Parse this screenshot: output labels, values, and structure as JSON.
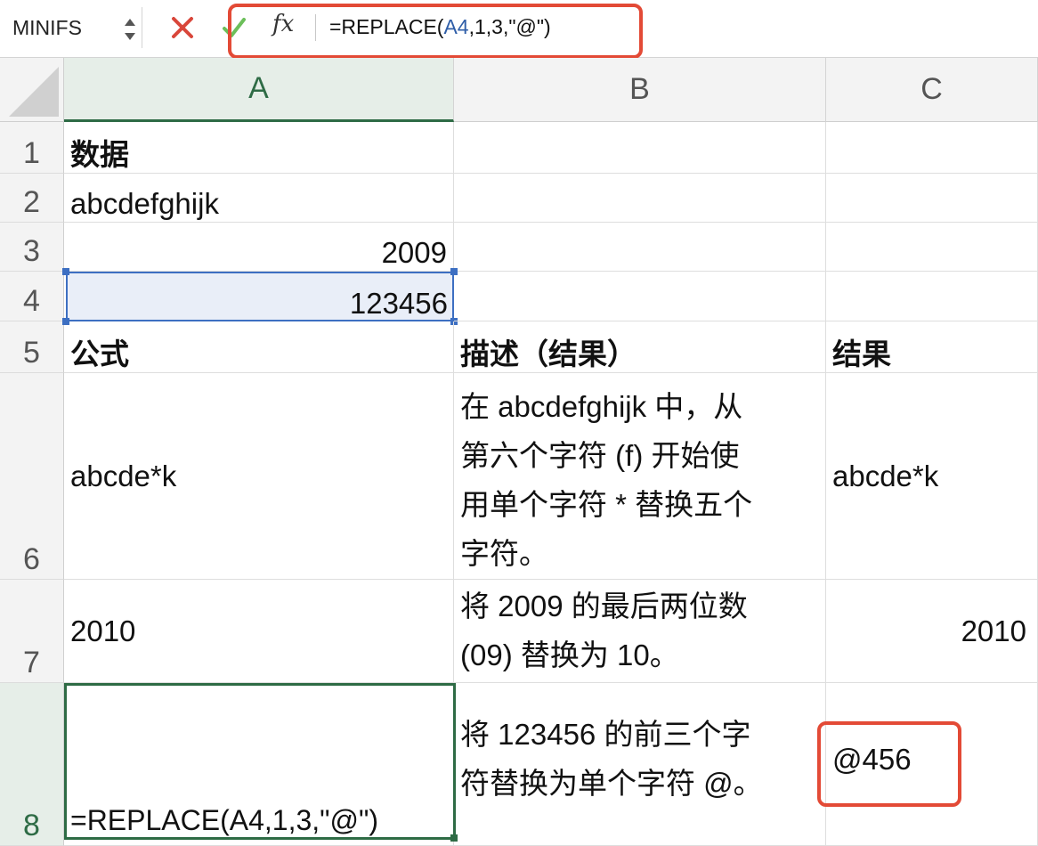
{
  "formula_bar": {
    "name_box": "MINIFS",
    "fx_label": "fx",
    "formula_parts": [
      "=REPLACE(",
      "A4",
      ",1,3,\"@\")"
    ]
  },
  "columns": [
    "A",
    "B",
    "C"
  ],
  "rows": [
    "1",
    "2",
    "3",
    "4",
    "5",
    "6",
    "7",
    "8"
  ],
  "cells": {
    "A1": "数据",
    "A2": "abcdefghijk",
    "A3": "2009",
    "A4": "123456",
    "A5": "公式",
    "B5": "描述（结果）",
    "C5": "结果",
    "A6": "abcde*k",
    "B6_lines": [
      "在 abcdefghijk 中，从",
      "第六个字符 (f) 开始使",
      "用单个字符 * 替换五个",
      "字符。"
    ],
    "C6": "abcde*k",
    "A7": "2010",
    "B7_lines": [
      "将 2009 的最后两位数",
      "(09) 替换为 10。"
    ],
    "C7": "2010",
    "A8": "=REPLACE(A4,1,3,\"@\")",
    "B8_lines": [
      "将 123456 的前三个字",
      "符替换为单个字符 @。"
    ],
    "C8": "@456"
  },
  "colors": {
    "highlight_red": "#e34a36",
    "active_green": "#2e6b45",
    "selection_blue": "#3d6fc2"
  }
}
